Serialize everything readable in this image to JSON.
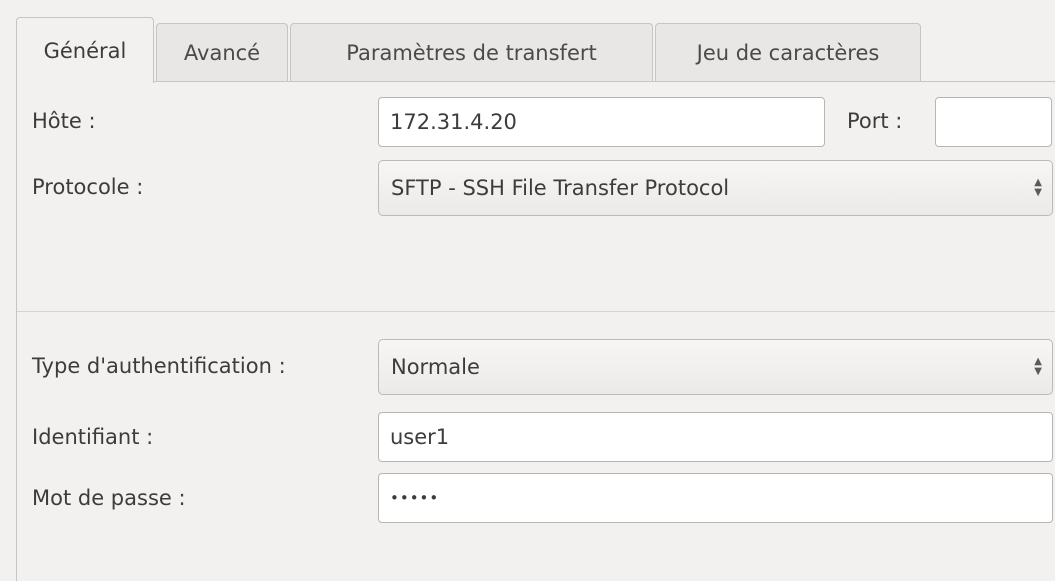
{
  "tabs": [
    {
      "label": "Général",
      "active": true
    },
    {
      "label": "Avancé",
      "active": false
    },
    {
      "label": "Paramètres de transfert",
      "active": false
    },
    {
      "label": "Jeu de caractères",
      "active": false
    }
  ],
  "general": {
    "host_label": "Hôte :",
    "host_value": "172.31.4.20",
    "port_label": "Port :",
    "port_value": "",
    "protocol_label": "Protocole :",
    "protocol_value": "SFTP - SSH File Transfer Protocol",
    "auth_type_label": "Type d'authentification :",
    "auth_type_value": "Normale",
    "login_label": "Identifiant :",
    "login_value": "user1",
    "password_label": "Mot de passe :",
    "password_mask": "•••••"
  },
  "icons": {
    "combo_arrows": "updown-arrows-icon"
  }
}
